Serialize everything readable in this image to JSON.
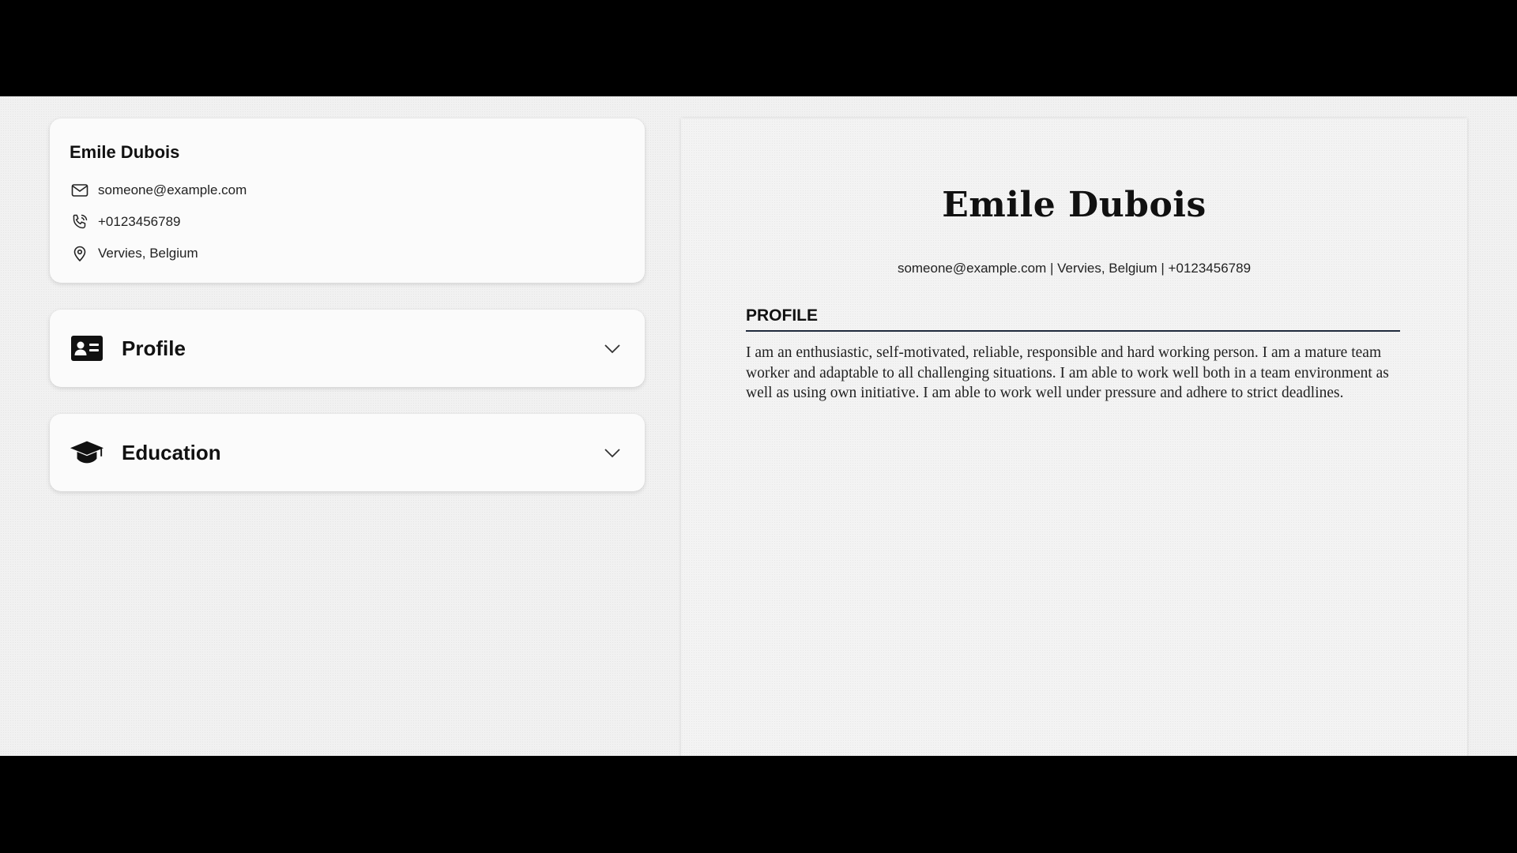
{
  "sidebar": {
    "contact": {
      "name": "Emile Dubois",
      "email": "someone@example.com",
      "phone": "+0123456789",
      "location": "Vervies, Belgium",
      "icons": [
        "envelope-icon",
        "phone-icon",
        "map-pin-icon"
      ]
    },
    "sections": [
      {
        "title": "Profile",
        "icon": "id-card-icon",
        "expanded": false
      },
      {
        "title": "Education",
        "icon": "graduation-cap-icon",
        "expanded": false
      }
    ]
  },
  "preview": {
    "name": "Emile Dubois",
    "contact_line": "someone@example.com | Vervies, Belgium | +0123456789",
    "profile_heading": "PROFILE",
    "profile_text": "I am an enthusiastic, self-motivated, reliable, responsible and hard working person. I am a mature team worker and adaptable to all challenging situations. I am able to work well both in a team environment as well as using own initiative. I am able to work well under pressure and adhere to strict deadlines."
  }
}
